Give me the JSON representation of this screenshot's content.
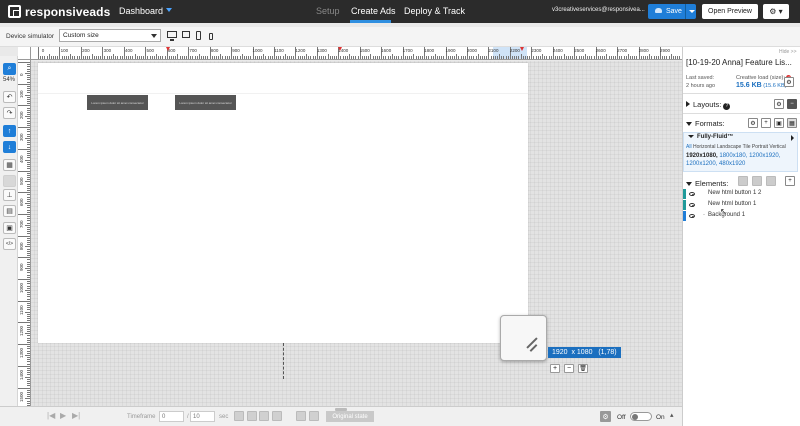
{
  "topbar": {
    "logo_text": "responsiveads",
    "nav": {
      "dashboard": "Dashboard",
      "setup": "Setup",
      "create_ads": "Create Ads",
      "deploy_track": "Deploy & Track"
    },
    "account": "v3creativeservices@responsivea...",
    "save_label": "Save",
    "open_preview_label": "Open Preview",
    "settings_icon": "gear-icon"
  },
  "toolbar": {
    "device_simulator_label": "Device simulator",
    "device_select_value": "Custom size"
  },
  "tools": {
    "zoom_level": "54%"
  },
  "rulers": {
    "h_numbers": [
      "0",
      "100",
      "200",
      "300",
      "400",
      "500",
      "600",
      "700",
      "800",
      "900",
      "1000",
      "1100",
      "1200",
      "1300",
      "1400",
      "1500",
      "1600",
      "1700",
      "1800",
      "1900",
      "2000",
      "2100",
      "2200",
      "2300",
      "2400",
      "2500",
      "2600",
      "2700",
      "2800",
      "2900"
    ],
    "v_numbers": [
      "0",
      "100",
      "200",
      "300",
      "400",
      "500",
      "600",
      "700",
      "800",
      "900",
      "1000",
      "1100",
      "1200",
      "1300",
      "1400",
      "1500"
    ]
  },
  "canvas": {
    "button1_text": "Lorem ipsum dolor sit amet consectetur",
    "button2_text": "Lorem ipsum dolor sit amet consectetur",
    "dimensions_readout": "1920  x 1080   (1,78)",
    "add_label": "+",
    "remove_label": "−",
    "delete_icon": "trash-icon"
  },
  "timeline": {
    "timeframe_label": "Timeframe",
    "current_time": "0",
    "total_time": "10",
    "sec_label": "sec",
    "original_state_label": "Original state",
    "toggle_off_label": "Off",
    "toggle_on_label": "On"
  },
  "panel": {
    "hide_label": "Hide >>",
    "project_title": "[10-19-20 Anna] Feature Lis...",
    "last_saved_label": "Last saved:",
    "last_saved_value": "2 hours ago",
    "creative_load_label": "Creative load (size):",
    "creative_load_kb": "15.6 KB",
    "creative_load_detail": "(15.6 KB)",
    "layouts_label": "Layouts:",
    "formats_label": "Formats:",
    "format_name": "Fully-Fluid™",
    "format_tabs": {
      "all": "All",
      "rest": "Horizontal Landscape Tile Portrait Vertical"
    },
    "format_selected_size": "1920x1080,",
    "format_sizes": "1800x180, 1200x1920, 1200x1200, 480x1920",
    "elements_label": "Elements:",
    "elements": [
      {
        "name": "New html button 1 2",
        "bar_color": "#1f9a9a"
      },
      {
        "name": "New html button 1",
        "bar_color": "#1f9a9a"
      },
      {
        "name": "Background 1",
        "bar_color": "#1f7ed8"
      }
    ]
  },
  "colors": {
    "accent": "#1f7ed8",
    "topbar": "#2b2b2b",
    "readout": "#1b6fbf"
  }
}
